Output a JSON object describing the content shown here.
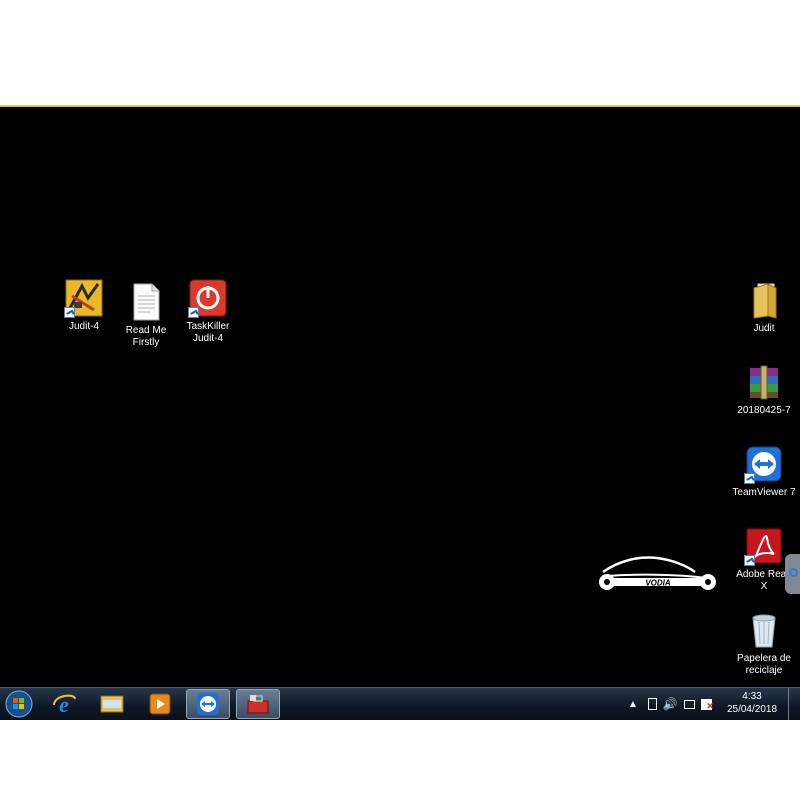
{
  "desktop": {
    "icons_left": [
      {
        "name": "judit-4-icon",
        "label": "Judit-4"
      },
      {
        "name": "read-me-icon",
        "label": "Read Me\nFirstly"
      },
      {
        "name": "taskkiller-icon",
        "label": "TaskKiller\nJudit-4"
      }
    ],
    "icons_right": [
      {
        "name": "folder-icon",
        "label": "Judit"
      },
      {
        "name": "winrar-archive-icon",
        "label": "20180425-7"
      },
      {
        "name": "teamviewer-icon",
        "label": "TeamViewer 7"
      },
      {
        "name": "adobe-reader-icon",
        "label": "Adobe Read\nX"
      },
      {
        "name": "recycle-bin-icon",
        "label": "Papelera de\nreciclaje"
      }
    ],
    "watermark_text": "VODIA"
  },
  "taskbar": {
    "start": "start-orb-icon",
    "pinned": [
      "internet-explorer-icon",
      "file-explorer-icon",
      "media-player-icon",
      "teamviewer-icon",
      "toolbox-icon"
    ],
    "clock": {
      "time": "4:33",
      "date": "25/04/2018"
    }
  },
  "colors": {
    "desktop_bg": "#000000",
    "taskbar_bg": "#0e1724",
    "top_line": "#d9c45a"
  }
}
